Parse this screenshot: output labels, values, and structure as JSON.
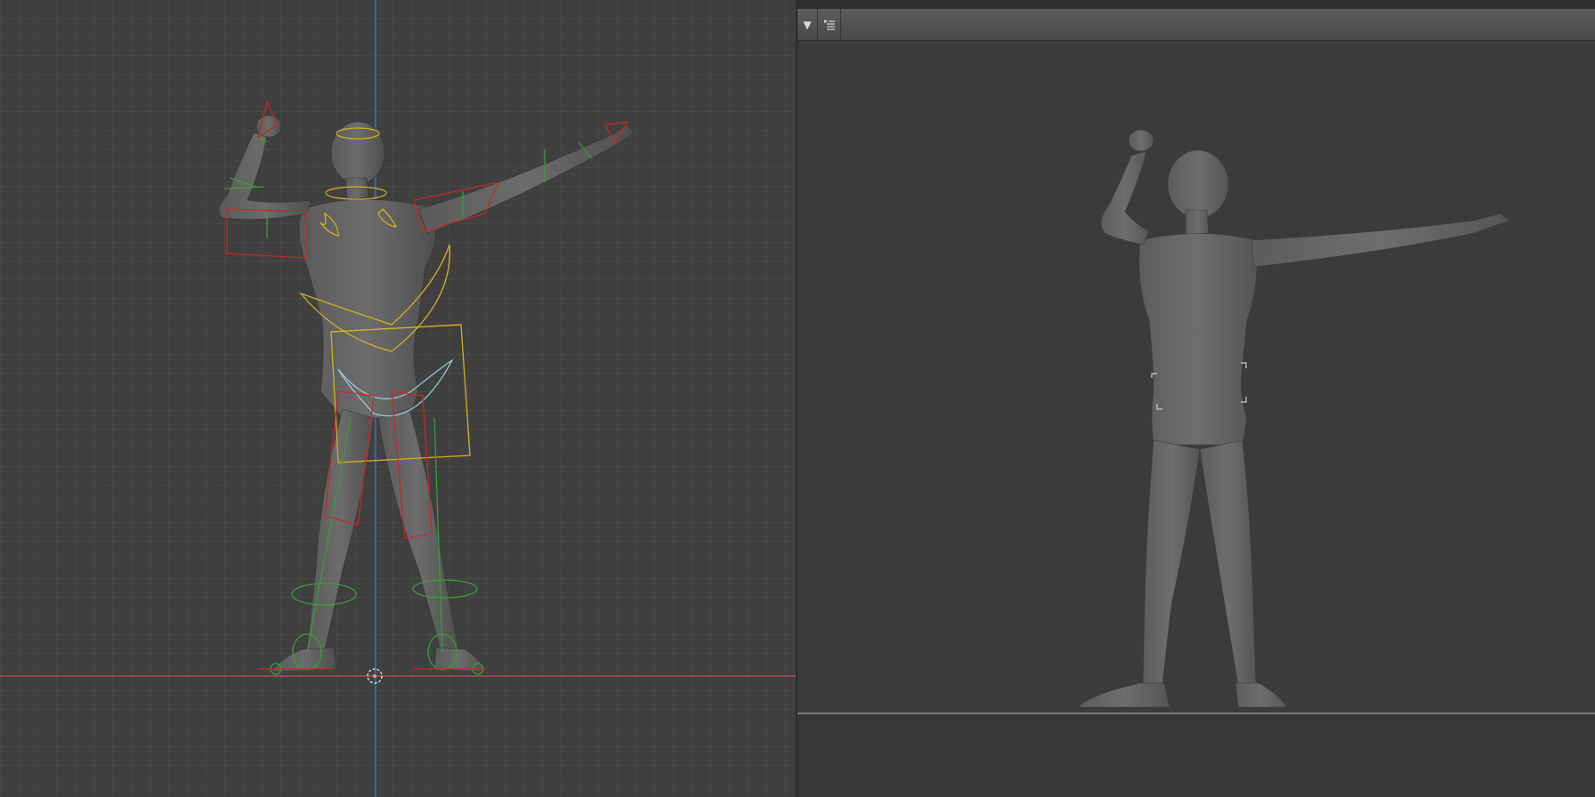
{
  "left_viewport": {
    "name": "rig-viewport",
    "grid_color": "#555555",
    "axis_x_color": "#b04a5a",
    "axis_y_color": "#3e6fb3",
    "bone_colors": {
      "ik": "#c62828",
      "fk": "#3a9d3a",
      "torso": "#d4b020",
      "hips": "#9ec9d6"
    }
  },
  "right_viewport": {
    "name": "render-preview",
    "header_icons": [
      "chevron-down-icon",
      "outliner-list-icon"
    ],
    "background": "#3b3b3b"
  }
}
